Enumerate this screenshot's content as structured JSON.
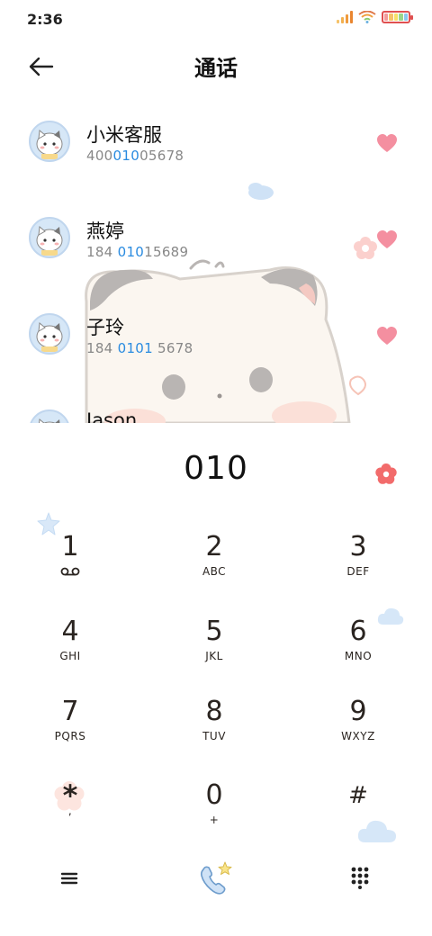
{
  "status_bar": {
    "time": "2:36"
  },
  "header": {
    "title": "通话",
    "back_icon": "arrow-left-icon"
  },
  "contacts": [
    {
      "name": "小米客服",
      "number_parts": [
        "400",
        "010",
        "05678"
      ]
    },
    {
      "name": "燕婷",
      "number_parts": [
        "184 ",
        "010",
        "15689"
      ]
    },
    {
      "name": "子玲",
      "number_parts": [
        "184 ",
        "0101",
        " 5678"
      ]
    },
    {
      "name": "Jason",
      "number_parts": [
        "",
        "",
        ""
      ]
    }
  ],
  "dialer": {
    "input_value": "010",
    "keys": [
      {
        "digit": "1",
        "letters": ""
      },
      {
        "digit": "2",
        "letters": "ABC"
      },
      {
        "digit": "3",
        "letters": "DEF"
      },
      {
        "digit": "4",
        "letters": "GHI"
      },
      {
        "digit": "5",
        "letters": "JKL"
      },
      {
        "digit": "6",
        "letters": "MNO"
      },
      {
        "digit": "7",
        "letters": "PQRS"
      },
      {
        "digit": "8",
        "letters": "TUV"
      },
      {
        "digit": "9",
        "letters": "WXYZ"
      },
      {
        "digit": "*",
        "letters": ","
      },
      {
        "digit": "0",
        "letters": "+"
      },
      {
        "digit": "#",
        "letters": ""
      }
    ]
  },
  "colors": {
    "highlight": "#2a8be0",
    "heart": "#f48fa0",
    "accent_flower": "#f26b6b",
    "text_dark": "#2a2420"
  },
  "icons": {
    "voicemail": "voicemail-icon",
    "menu": "menu-icon",
    "call": "phone-call-icon",
    "dialpad": "dialpad-icon",
    "favorite": "heart-icon",
    "flower": "flower-icon"
  }
}
